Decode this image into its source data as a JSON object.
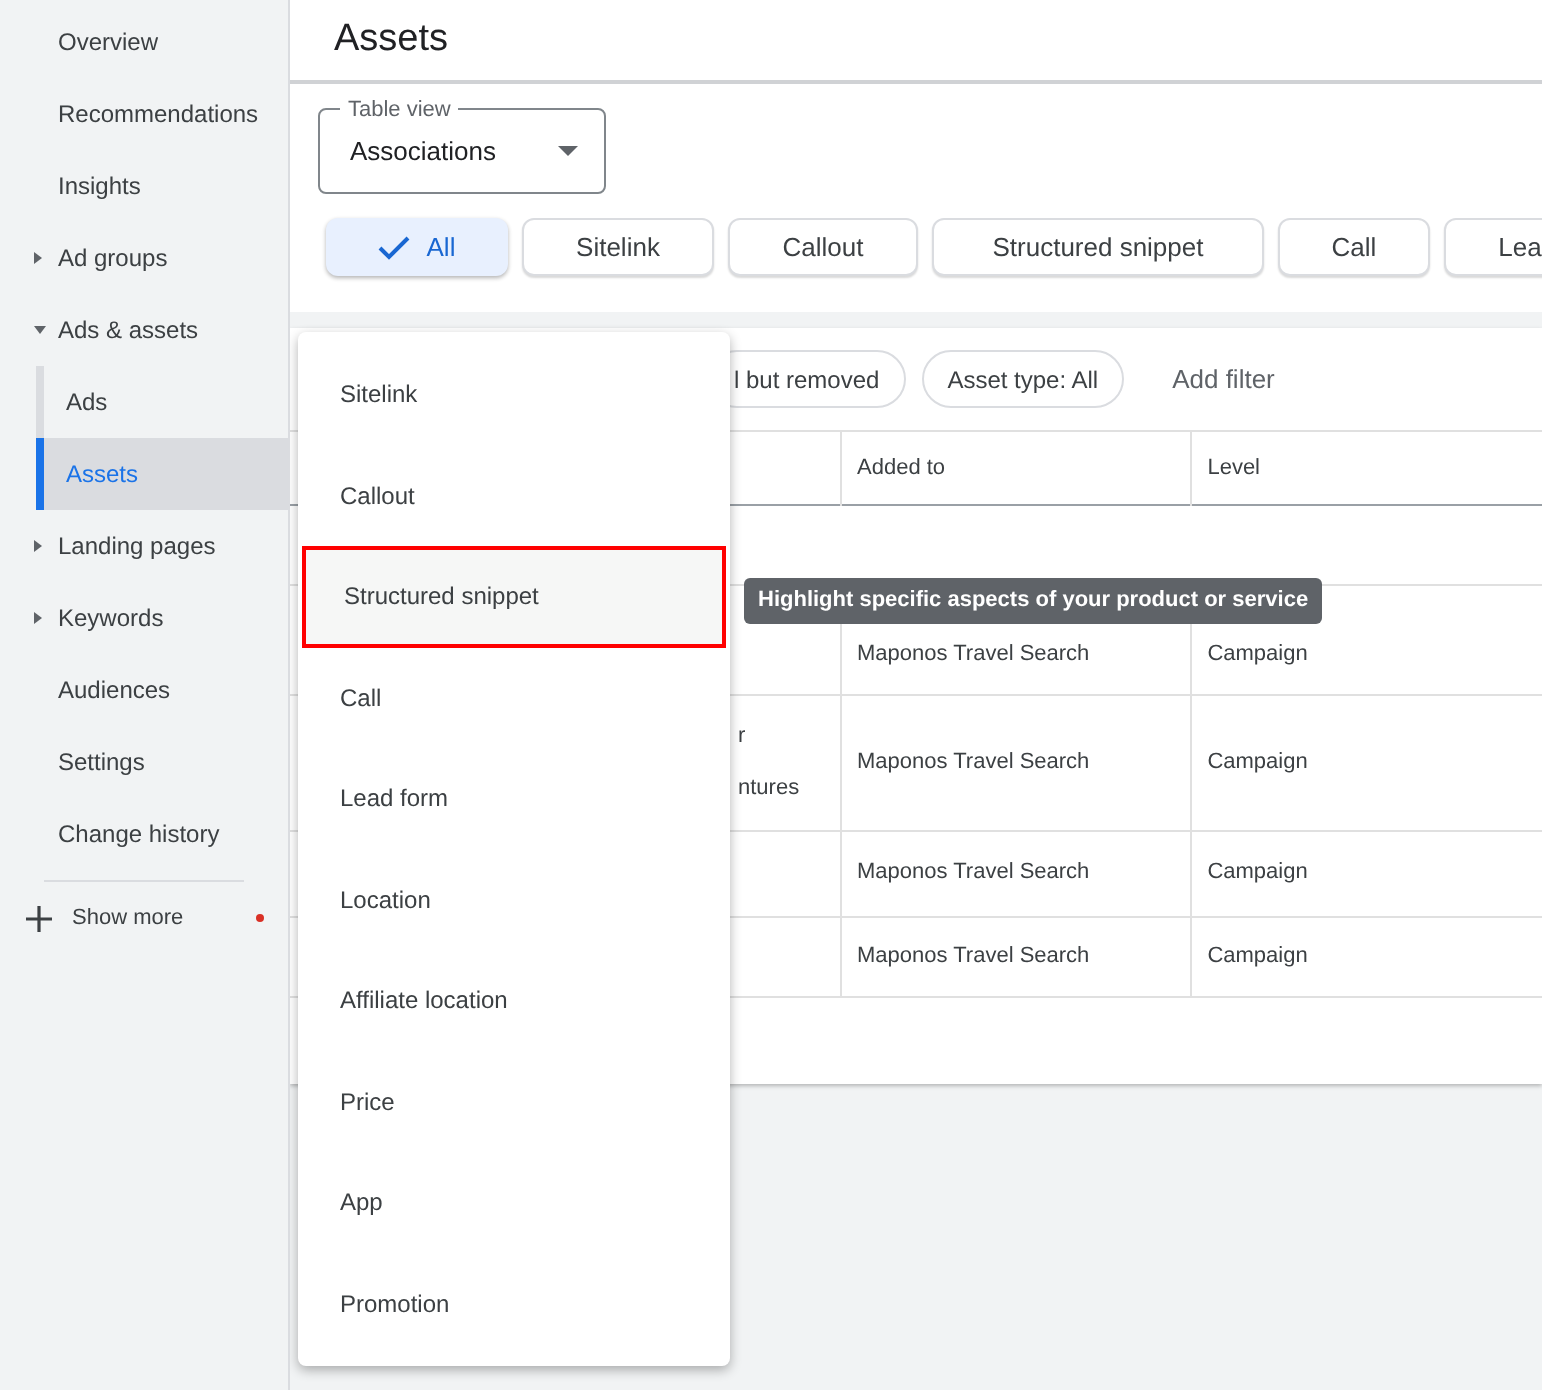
{
  "sidebar": {
    "items": [
      {
        "label": "Overview",
        "selected": false
      },
      {
        "label": "Recommendations",
        "selected": false
      },
      {
        "label": "Insights",
        "selected": false
      },
      {
        "label": "Ad groups",
        "expanded": false,
        "selected": false
      },
      {
        "label": "Ads & assets",
        "expanded": true,
        "selected": false,
        "children": [
          {
            "label": "Ads",
            "selected": false
          },
          {
            "label": "Assets",
            "selected": true
          }
        ]
      },
      {
        "label": "Landing pages",
        "expanded": false,
        "selected": false
      },
      {
        "label": "Keywords",
        "expanded": false,
        "selected": false
      },
      {
        "label": "Audiences",
        "selected": false
      },
      {
        "label": "Settings",
        "selected": false
      },
      {
        "label": "Change history",
        "selected": false
      }
    ],
    "show_more": {
      "label": "Show more",
      "notification": true
    }
  },
  "page_title": "Assets",
  "table_view": {
    "label": "Table view",
    "value": "Associations"
  },
  "type_chips": [
    {
      "label": "All",
      "selected": true
    },
    {
      "label": "Sitelink",
      "selected": false
    },
    {
      "label": "Callout",
      "selected": false
    },
    {
      "label": "Structured snippet",
      "selected": false
    },
    {
      "label": "Call",
      "selected": false
    },
    {
      "label": "Lea",
      "selected": false
    }
  ],
  "filters": {
    "chips": [
      "l but removed",
      "Asset type: All"
    ],
    "add_filter": "Add filter"
  },
  "table": {
    "columns": [
      "Added to",
      "Level"
    ],
    "rows": [
      {
        "kind": "group"
      },
      {
        "added_to": "Maponos Travel Search",
        "level": "Campaign"
      },
      {
        "column_1": [
          "r",
          "ntures"
        ],
        "added_to": "Maponos Travel Search",
        "level": "Campaign"
      },
      {
        "added_to": "Maponos Travel Search",
        "level": "Campaign"
      },
      {
        "added_to": "Maponos Travel Search",
        "level": "Campaign"
      }
    ]
  },
  "menu": {
    "items": [
      {
        "label": "Sitelink",
        "highlighted": false
      },
      {
        "label": "Callout",
        "highlighted": false
      },
      {
        "label": "Structured snippet",
        "highlighted": true
      },
      {
        "label": "Call",
        "highlighted": false
      },
      {
        "label": "Lead form",
        "highlighted": false
      },
      {
        "label": "Location",
        "highlighted": false
      },
      {
        "label": "Affiliate location",
        "highlighted": false
      },
      {
        "label": "Price",
        "highlighted": false
      },
      {
        "label": "App",
        "highlighted": false
      },
      {
        "label": "Promotion",
        "highlighted": false
      }
    ]
  },
  "tooltip": "Highlight specific aspects of your product or service"
}
